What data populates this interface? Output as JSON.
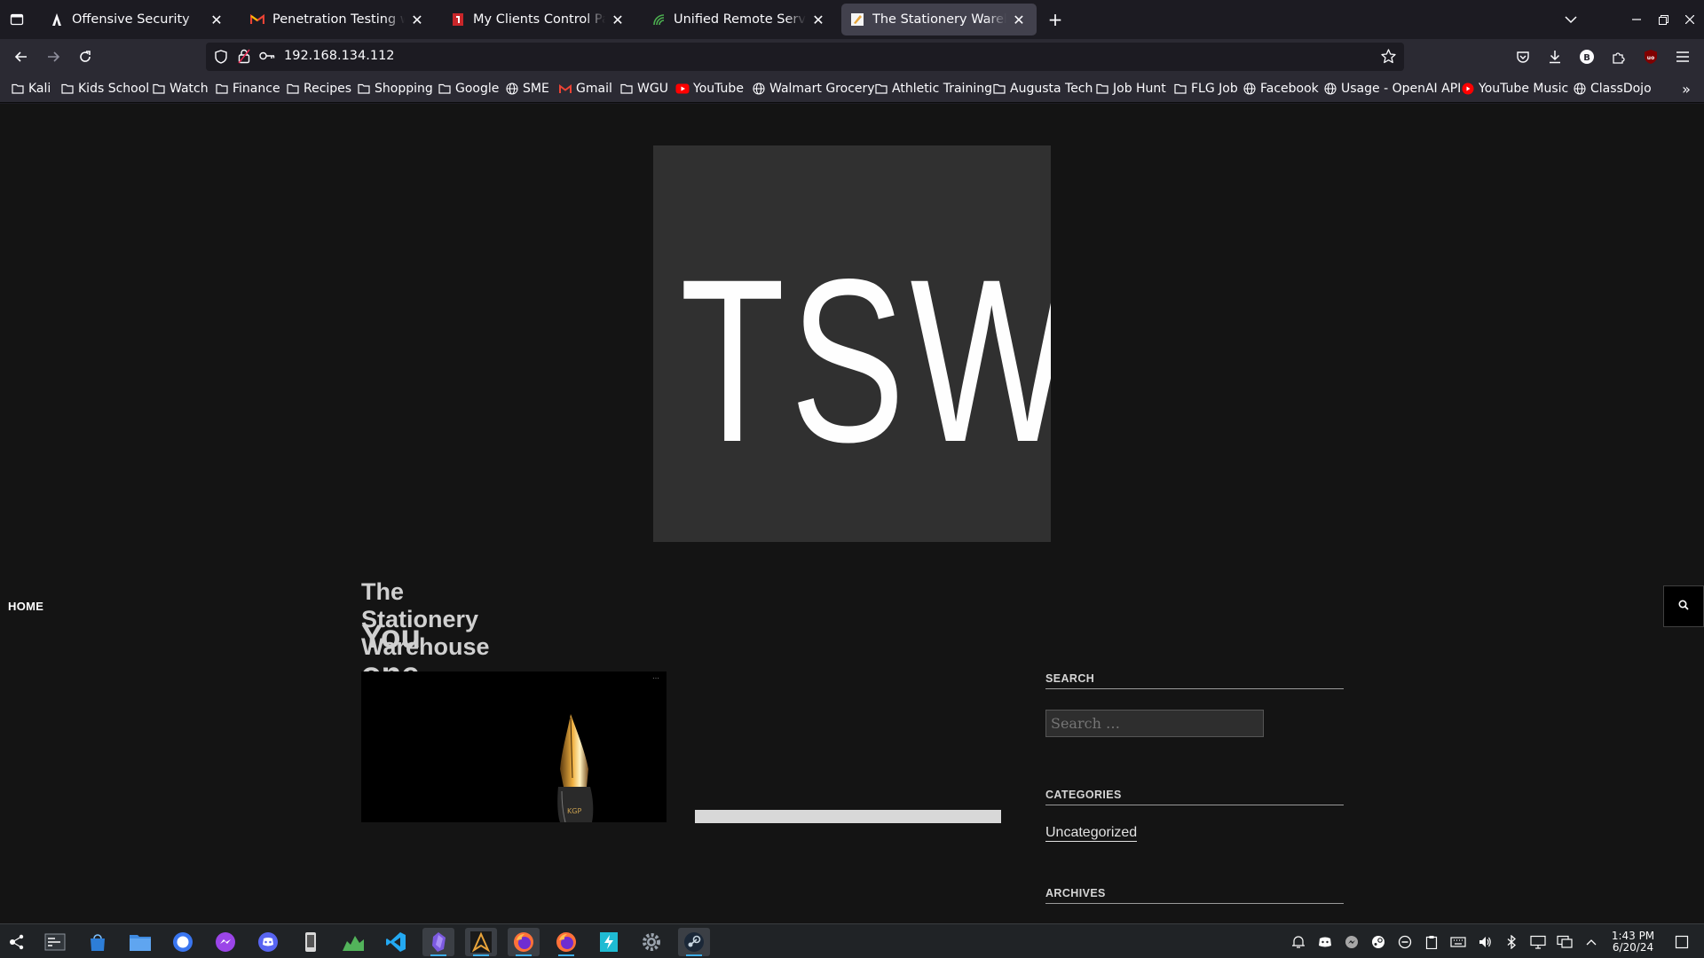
{
  "browser": {
    "tabs": [
      {
        "title": "Offensive Security",
        "icon": "offsec-icon",
        "active": false
      },
      {
        "title": "Penetration Testing with Kali",
        "icon": "gmail-icon",
        "active": false
      },
      {
        "title": "My Clients Control Panel | ",
        "icon": "client-panel-icon",
        "active": false
      },
      {
        "title": "Unified Remote Server",
        "icon": "unified-remote-icon",
        "active": false
      },
      {
        "title": "The Stationery Warehouse",
        "icon": "stationery-favicon-icon",
        "active": true
      }
    ],
    "url": "192.168.134.112",
    "bookmarks": [
      {
        "label": "Kali",
        "icon": "folder-icon"
      },
      {
        "label": "Kids School",
        "icon": "folder-icon"
      },
      {
        "label": "Watch",
        "icon": "folder-icon"
      },
      {
        "label": "Finance",
        "icon": "folder-icon"
      },
      {
        "label": "Recipes",
        "icon": "folder-icon"
      },
      {
        "label": "Shopping",
        "icon": "folder-icon"
      },
      {
        "label": "Google",
        "icon": "folder-icon"
      },
      {
        "label": "SME",
        "icon": "globe-icon"
      },
      {
        "label": "Gmail",
        "icon": "gmail-icon"
      },
      {
        "label": "WGU",
        "icon": "folder-icon"
      },
      {
        "label": "YouTube",
        "icon": "youtube-icon"
      },
      {
        "label": "Walmart Grocery",
        "icon": "globe-icon"
      },
      {
        "label": "Athletic Training",
        "icon": "folder-icon"
      },
      {
        "label": "Augusta Tech",
        "icon": "folder-icon"
      },
      {
        "label": "Job Hunt",
        "icon": "folder-icon"
      },
      {
        "label": "FLG Job",
        "icon": "folder-icon"
      },
      {
        "label": "Facebook",
        "icon": "globe-icon"
      },
      {
        "label": "Usage - OpenAI API",
        "icon": "globe-icon"
      },
      {
        "label": "YouTube Music",
        "icon": "youtube-music-icon"
      },
      {
        "label": "ClassDojo",
        "icon": "globe-icon"
      }
    ]
  },
  "site": {
    "logo_text": "TSW",
    "menu": {
      "home": "HOME"
    },
    "title": "The Stationery Warehouse",
    "tagline": "You one-stop pencil shop!",
    "sidebar": {
      "search_heading": "SEARCH",
      "search_placeholder": "Search …",
      "categories_heading": "CATEGORIES",
      "category_link": "Uncategorized",
      "archives_heading": "ARCHIVES"
    }
  },
  "taskbar": {
    "apps": [
      "application-launcher-icon",
      "terminal-icon",
      "store-icon",
      "file-manager-icon",
      "signal-icon",
      "messenger-icon",
      "discord-icon",
      "phone-link-icon",
      "system-monitor-icon",
      "vscode-icon",
      "obsidian-icon",
      "archlinux-icon",
      "firefox-icon",
      "firefox-icon",
      "kdeconnect-icon",
      "settings-icon",
      "steam-icon"
    ],
    "time": "1:43 PM",
    "date": "6/20/24"
  },
  "colors": {
    "page_bg": "#141414",
    "logo_bg": "#303030",
    "tab_active": "#42414d",
    "toolbar_bg": "#2b2a33"
  }
}
